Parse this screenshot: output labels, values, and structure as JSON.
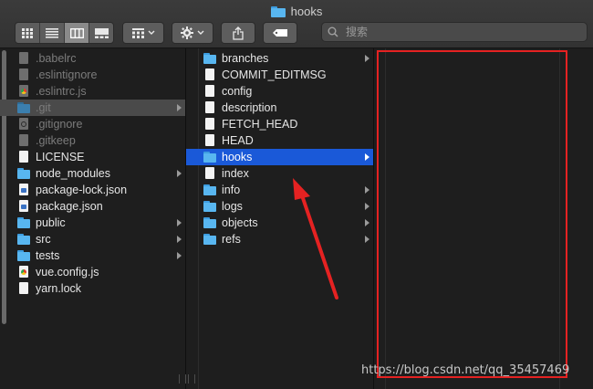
{
  "window": {
    "title": "hooks"
  },
  "toolbar": {
    "view_buttons": [
      "icon-view",
      "list-view",
      "column-view",
      "gallery-view"
    ],
    "active_view": "column-view",
    "group_icon": "group-grid-icon",
    "action_icon": "gear-icon",
    "share_icon": "share-icon",
    "tag_icon": "tag-icon",
    "search_placeholder": "搜索"
  },
  "column1": {
    "items": [
      {
        "label": ".babelrc",
        "icon": "file",
        "dim": true,
        "folder": false
      },
      {
        "label": ".eslintignore",
        "icon": "file",
        "dim": true,
        "folder": false
      },
      {
        "label": ".eslintrc.js",
        "icon": "chrome-file",
        "dim": true,
        "folder": false
      },
      {
        "label": ".git",
        "icon": "folder",
        "dim": true,
        "folder": true,
        "selected": "inactive"
      },
      {
        "label": ".gitignore",
        "icon": "gear-file",
        "dim": true,
        "folder": false
      },
      {
        "label": ".gitkeep",
        "icon": "file",
        "dim": true,
        "folder": false
      },
      {
        "label": "LICENSE",
        "icon": "file",
        "dim": false,
        "folder": false
      },
      {
        "label": "node_modules",
        "icon": "folder",
        "dim": false,
        "folder": true
      },
      {
        "label": "package-lock.json",
        "icon": "json-file",
        "dim": false,
        "folder": false
      },
      {
        "label": "package.json",
        "icon": "json-file",
        "dim": false,
        "folder": false
      },
      {
        "label": "public",
        "icon": "folder",
        "dim": false,
        "folder": true
      },
      {
        "label": "src",
        "icon": "folder",
        "dim": false,
        "folder": true
      },
      {
        "label": "tests",
        "icon": "folder",
        "dim": false,
        "folder": true
      },
      {
        "label": "vue.config.js",
        "icon": "chrome-file",
        "dim": false,
        "folder": false
      },
      {
        "label": "yarn.lock",
        "icon": "file",
        "dim": false,
        "folder": false
      }
    ]
  },
  "column2": {
    "items": [
      {
        "label": "branches",
        "icon": "folder",
        "folder": true
      },
      {
        "label": "COMMIT_EDITMSG",
        "icon": "file",
        "folder": false
      },
      {
        "label": "config",
        "icon": "file",
        "folder": false
      },
      {
        "label": "description",
        "icon": "file",
        "folder": false
      },
      {
        "label": "FETCH_HEAD",
        "icon": "file",
        "folder": false
      },
      {
        "label": "HEAD",
        "icon": "file",
        "folder": false
      },
      {
        "label": "hooks",
        "icon": "folder",
        "folder": true,
        "selected": "active"
      },
      {
        "label": "index",
        "icon": "file",
        "folder": false
      },
      {
        "label": "info",
        "icon": "folder",
        "folder": true
      },
      {
        "label": "logs",
        "icon": "folder",
        "folder": true
      },
      {
        "label": "objects",
        "icon": "folder",
        "folder": true
      },
      {
        "label": "refs",
        "icon": "folder",
        "folder": true
      }
    ]
  },
  "column3": {
    "items": []
  },
  "watermark": "https://blog.csdn.net/qq_35457469",
  "colors": {
    "selection": "#1a59d8",
    "annotation": "#e52222",
    "folder": "#58b6f0"
  }
}
